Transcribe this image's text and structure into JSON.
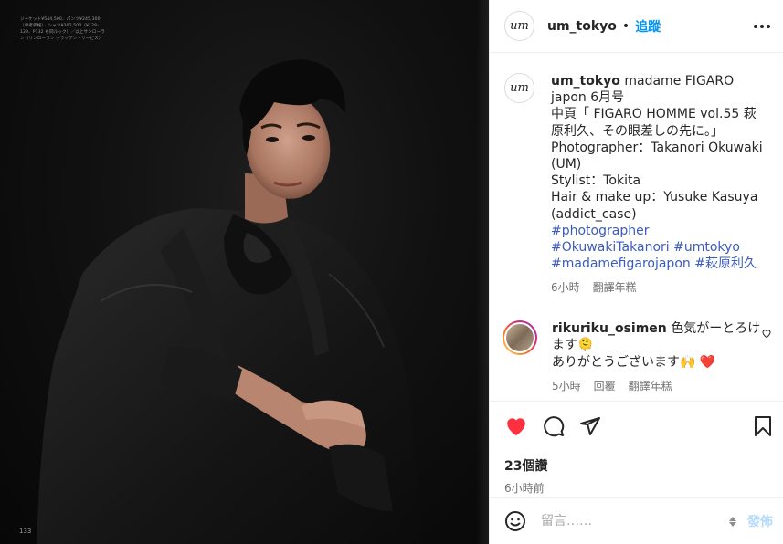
{
  "photo": {
    "credit_text": "ジャケット¥544,500、パンツ¥245,300（参考価格）、シャツ¥302,500（¥128-129、P132 も同ルック）／以上サンローラン（サンローラン クライアントサービス）",
    "page_number": "133"
  },
  "header": {
    "avatar_text": "um",
    "username": "um_tokyo",
    "separator": "•",
    "follow_label": "追蹤",
    "more_icon": "ellipsis-icon"
  },
  "caption": {
    "avatar_text": "um",
    "username": "um_tokyo",
    "line1": " madame FIGARO japon 6月号",
    "line2": "中頁「 FIGARO HOMME vol.55 萩原利久、その眼差しの先に。」",
    "line3": "Photographer：Takanori Okuwaki (UM)",
    "line4": "Stylist：Tokita",
    "line5": "Hair & make up：Yusuke Kasuya (addict_case)",
    "hashtags": [
      "#photographer",
      "#OkuwakiTakanori",
      "#umtokyo",
      "#madamefigarojapon",
      "#萩原利久"
    ],
    "time": "6小時",
    "translate_label": "翻譯年糕"
  },
  "comment": {
    "username": "rikuriku_osimen",
    "text_line1": " 色気がーとろけます🫠",
    "text_line2": "ありがとうございます🙌 ❤️",
    "time": "5小時",
    "reply_label": "回覆",
    "translate_label": "翻譯年糕",
    "like_icon": "heart-outline-icon"
  },
  "actions": {
    "like_icon": "heart-filled-icon",
    "like_color": "#ff3040",
    "comment_icon": "speech-bubble-icon",
    "share_icon": "paper-plane-icon",
    "save_icon": "bookmark-icon",
    "likes": "23個讚",
    "posted_time": "6小時前"
  },
  "composer": {
    "emoji_icon": "smiley-icon",
    "placeholder": "留言……",
    "post_label": "發佈"
  }
}
